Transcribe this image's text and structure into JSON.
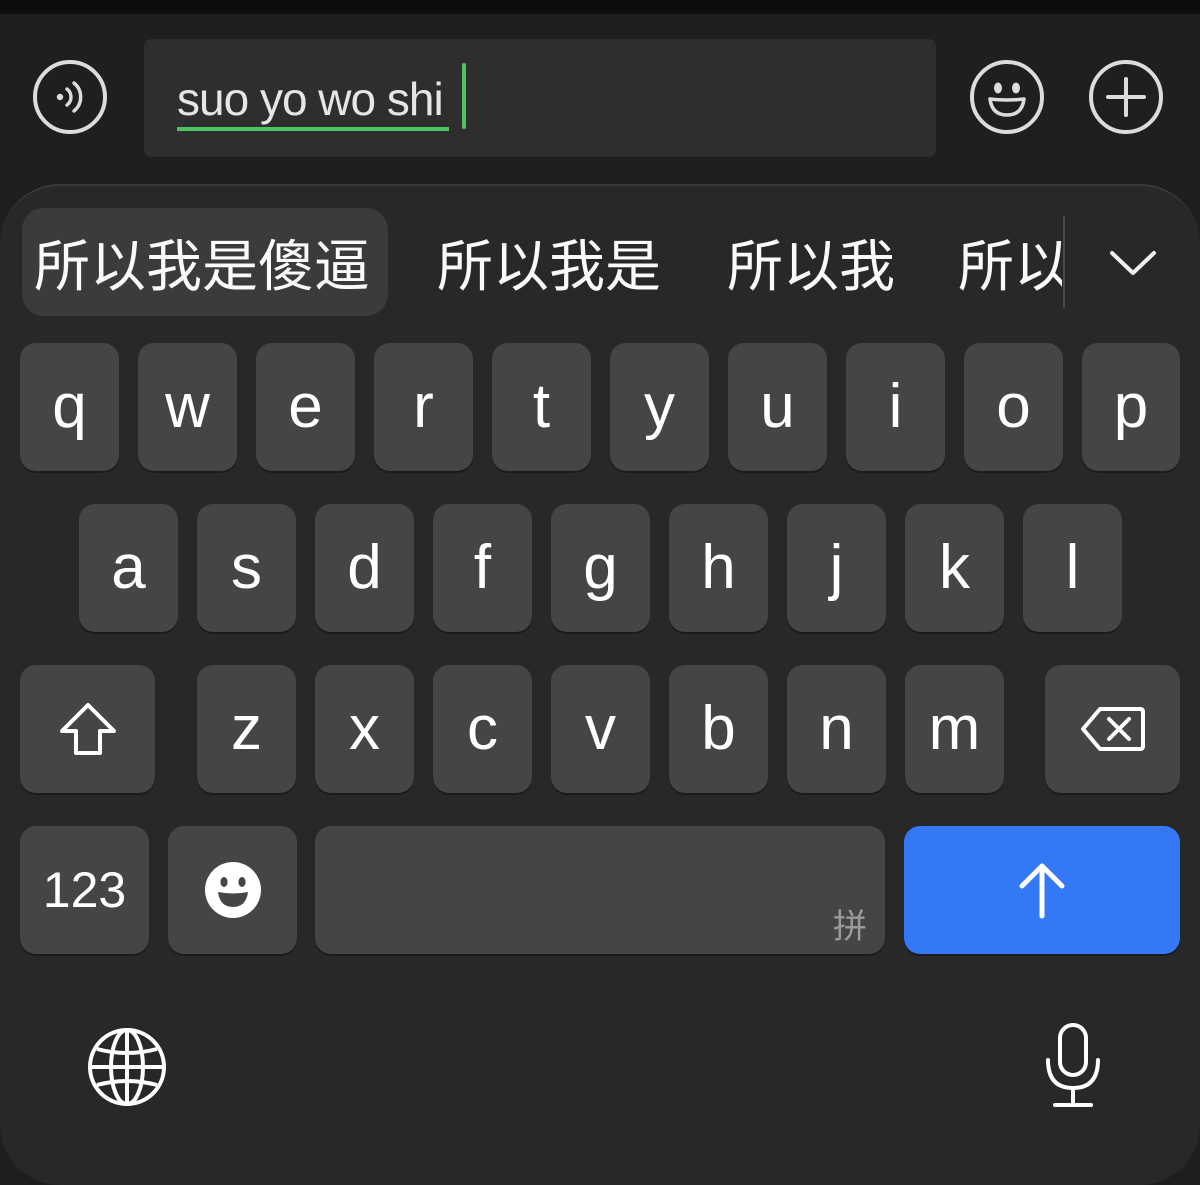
{
  "input_bar": {
    "composing_text": "suo yo wo shi",
    "left_icon": "voice-wave-icon",
    "right_icons": [
      "emoji-icon",
      "plus-icon"
    ]
  },
  "candidates": {
    "items": [
      "所以我是傻逼",
      "所以我是",
      "所以我",
      "所以"
    ],
    "expand_icon": "chevron-down-icon"
  },
  "keyboard": {
    "row1": [
      "q",
      "w",
      "e",
      "r",
      "t",
      "y",
      "u",
      "i",
      "o",
      "p"
    ],
    "row2": [
      "a",
      "s",
      "d",
      "f",
      "g",
      "h",
      "j",
      "k",
      "l"
    ],
    "row3": [
      "z",
      "x",
      "c",
      "v",
      "b",
      "n",
      "m"
    ],
    "shift_icon": "shift-arrow-icon",
    "delete_icon": "backspace-icon",
    "numbers_label": "123",
    "emoji_icon": "emoji-face-icon",
    "space_hint": "拼",
    "return_icon": "up-arrow-icon",
    "globe_icon": "globe-icon",
    "mic_icon": "microphone-icon"
  },
  "colors": {
    "accent_green": "#4cc463",
    "return_blue": "#3478f6",
    "key_bg": "#454545",
    "panel_bg": "#282828"
  }
}
